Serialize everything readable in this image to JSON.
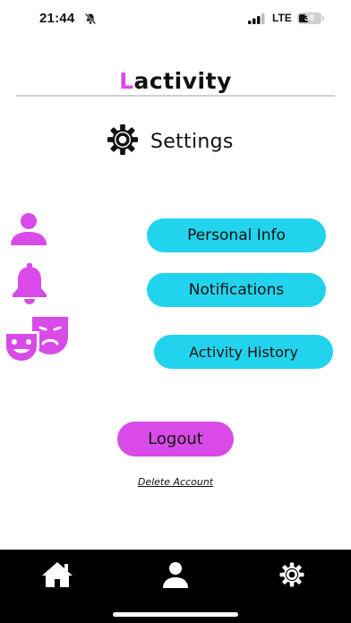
{
  "status_bar": {
    "time": "21:44",
    "network": "LTE",
    "battery": "36",
    "icons": [
      "bell-off-icon",
      "signal-icon",
      "battery-icon"
    ]
  },
  "app": {
    "title_first_letter": "L",
    "title_rest": "activity"
  },
  "settings": {
    "title": "Settings",
    "icon": "gear-icon"
  },
  "menu": {
    "personal_info": "Personal Info",
    "notifications": "Notifications",
    "activity_history": "Activity History",
    "icons": [
      "person-icon",
      "bell-icon",
      "theater-masks-icon"
    ]
  },
  "actions": {
    "logout": "Logout",
    "delete_account": "Delete Account"
  },
  "tab_bar": {
    "items": [
      "home-icon",
      "profile-icon",
      "gear-icon"
    ]
  },
  "colors": {
    "accent": "#d94be8",
    "button": "#22d3ee",
    "tab_bar": "#000000"
  }
}
